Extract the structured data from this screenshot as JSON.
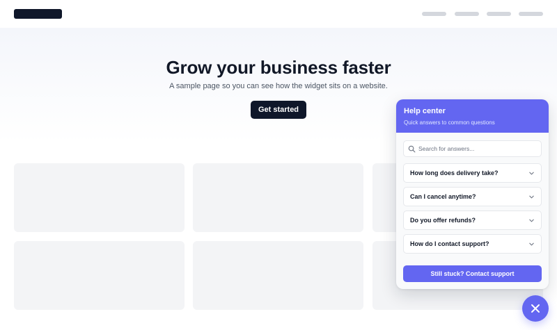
{
  "hero": {
    "title": "Grow your business faster",
    "subtitle": "A sample page so you can see how the widget sits on a website.",
    "cta_label": "Get started"
  },
  "widget": {
    "title": "Help center",
    "subtitle": "Quick answers to common questions",
    "search_placeholder": "Search for answers...",
    "faqs": [
      {
        "question": "How long does delivery take?"
      },
      {
        "question": "Can I cancel anytime?"
      },
      {
        "question": "Do you offer refunds?"
      },
      {
        "question": "How do I contact support?"
      }
    ],
    "contact_label": "Still stuck? Contact support",
    "close_icon": "close-icon"
  },
  "colors": {
    "accent": "#6366f1",
    "dark": "#0f172a",
    "placeholder": "#f3f4f6"
  }
}
